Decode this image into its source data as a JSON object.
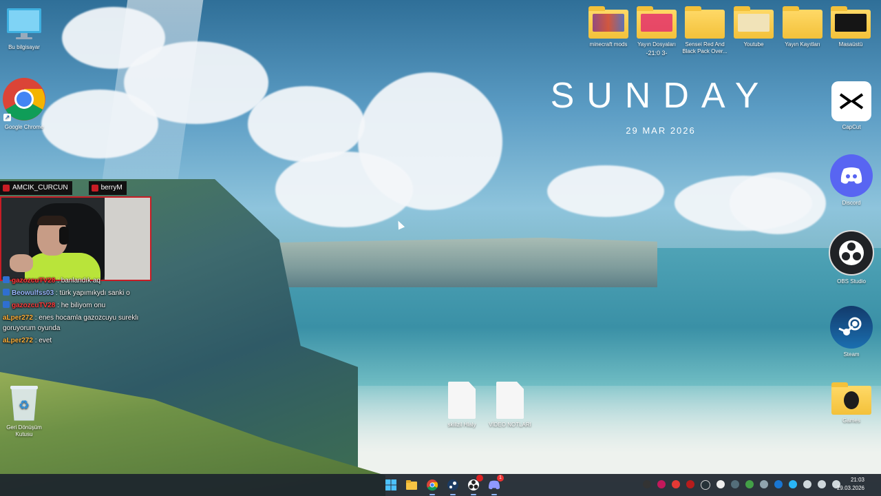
{
  "clock_widget": {
    "day": "SUNDAY",
    "date": "29 MAR 2026"
  },
  "desktop_icons_left": [
    {
      "label": "Bu bilgisayar",
      "icon": "monitor-icon"
    },
    {
      "label": "Google Chrome",
      "icon": "chrome-icon"
    },
    {
      "label": "Geri Dönüşüm Kutusu",
      "icon": "recycle-bin-icon"
    }
  ],
  "desktop_icons_top": [
    {
      "label": "minecraft mods",
      "icon": "folder-icon"
    },
    {
      "label": "Yayın Dosyaları",
      "sublabel": "-21:0 3-",
      "icon": "folder-icon"
    },
    {
      "label": "Sensei Red And Black Pack Over...",
      "icon": "folder-icon"
    },
    {
      "label": "Youtube",
      "icon": "folder-icon"
    },
    {
      "label": "Yayın Kayıtları",
      "icon": "folder-icon"
    },
    {
      "label": "Masaüstü",
      "icon": "folder-icon"
    }
  ],
  "desktop_icons_right": [
    {
      "label": "CapCut",
      "icon": "capcut-icon"
    },
    {
      "label": "Discord",
      "icon": "discord-icon"
    },
    {
      "label": "OBS Studio",
      "icon": "obs-icon"
    },
    {
      "label": "Steam",
      "icon": "steam-icon"
    },
    {
      "label": "Games",
      "icon": "folder-icon"
    }
  ],
  "desktop_icons_center": [
    {
      "label": "skillzil Hlaly",
      "icon": "text-file-icon"
    },
    {
      "label": "VİDEO NOTLARI",
      "icon": "text-file-icon"
    }
  ],
  "webcam": {
    "tabs": [
      "AMCIK_CURCUN",
      "berryM"
    ]
  },
  "chat": [
    {
      "user": "gazozcuTV28",
      "message": ": banlandık aq",
      "color": "#ff3b3b",
      "badge": true
    },
    {
      "user": "Beowulfss03",
      "message": ": türk yapımıkydı sanki o",
      "color": "#9ab8ff",
      "badge": true
    },
    {
      "user": "gazozcuTV28",
      "message": ": he biliyom onu",
      "color": "#ff3b3b",
      "badge": true
    },
    {
      "user": "aLper272",
      "message": ": enes hocamla gazozcuyu sureklı goruyorum oyunda",
      "color": "#ffb13b",
      "badge": false
    },
    {
      "user": "aLper272",
      "message": ": evet",
      "color": "#ffb13b",
      "badge": false
    }
  ],
  "taskbar": {
    "apps": [
      "windows-start-icon",
      "file-explorer-icon",
      "chrome-icon",
      "steam-icon",
      "obs-icon",
      "discord-icon"
    ],
    "discord_badge": "1",
    "time": "21:03",
    "date": "29.03.2026"
  }
}
